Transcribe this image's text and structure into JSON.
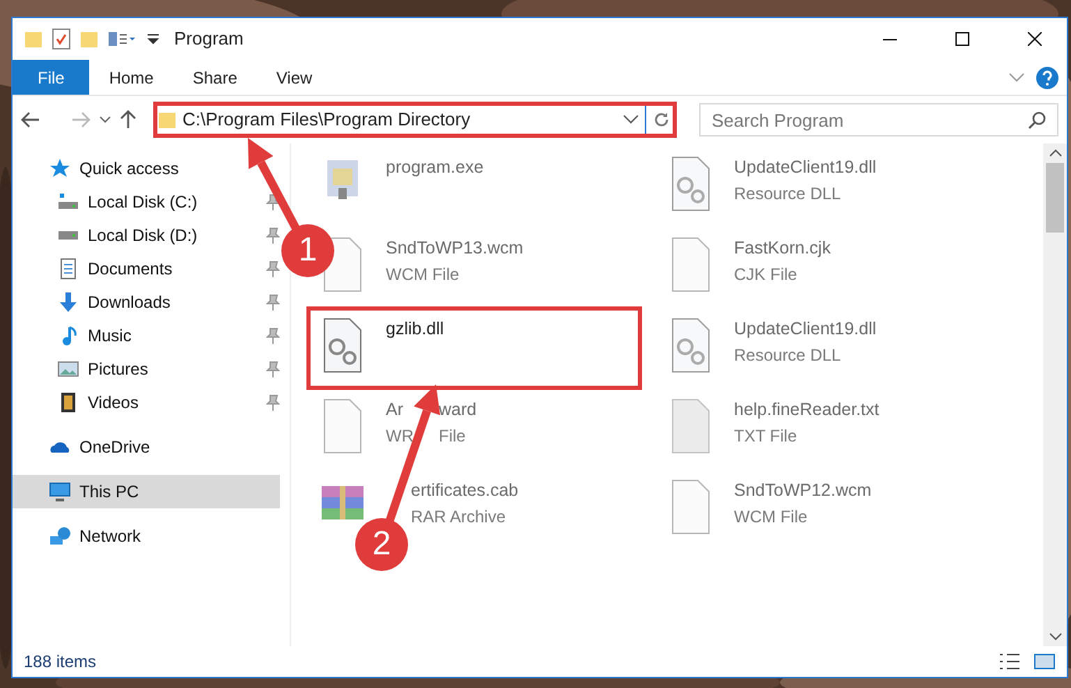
{
  "window": {
    "title": "Program"
  },
  "ribbon_tabs": [
    {
      "label": "File",
      "selected": true
    },
    {
      "label": "Home",
      "selected": false
    },
    {
      "label": "Share",
      "selected": false
    },
    {
      "label": "View",
      "selected": false
    }
  ],
  "address": {
    "path": "C:\\Program Files\\Program Directory",
    "highlighted": true
  },
  "search": {
    "placeholder": "Search Program"
  },
  "sidebar": {
    "items": [
      {
        "label": "Quick access",
        "kind": "star",
        "selected": false,
        "children": [
          {
            "label": "Local Disk (C:)",
            "kind": "disk-c",
            "pinned": true,
            "selected": false
          },
          {
            "label": "Local Disk (D:)",
            "kind": "disk",
            "pinned": true,
            "selected": false
          },
          {
            "label": "Documents",
            "kind": "documents",
            "pinned": true,
            "selected": false
          },
          {
            "label": "Downloads",
            "kind": "downloads",
            "pinned": true,
            "selected": false
          },
          {
            "label": "Music",
            "kind": "music",
            "pinned": true,
            "selected": false
          },
          {
            "label": "Pictures",
            "kind": "pictures",
            "pinned": true,
            "selected": false
          },
          {
            "label": "Videos",
            "kind": "videos",
            "pinned": true,
            "selected": false
          }
        ]
      },
      {
        "label": "OneDrive",
        "kind": "cloud",
        "selected": false
      },
      {
        "label": "This PC",
        "kind": "pc",
        "selected": true
      },
      {
        "label": "Network",
        "kind": "network",
        "selected": false
      }
    ]
  },
  "files": [
    {
      "name": "program.exe",
      "kind": "exe",
      "faded": true,
      "highlighted": false
    },
    {
      "name": "UpdateClient19.dll",
      "type": "Resource DLL",
      "kind": "dll",
      "faded": true,
      "highlighted": false
    },
    {
      "name": "SndToWP13.wcm",
      "type": "WCM File",
      "kind": "blank",
      "faded": true,
      "highlighted": false
    },
    {
      "name": "FastKorn.cjk",
      "type": "CJK File",
      "kind": "blank",
      "faded": true,
      "highlighted": false
    },
    {
      "name": "gzlib.dll",
      "kind": "dll",
      "faded": false,
      "highlighted": true
    },
    {
      "name": "UpdateClient19.dll",
      "type": "Resource DLL",
      "kind": "dll",
      "faded": true,
      "highlighted": false
    },
    {
      "name": "Ar",
      "name_rest": "ward",
      "type": "WR",
      "type_rest": "File",
      "kind": "blank",
      "faded": true,
      "highlighted": false
    },
    {
      "name": "help.fineReader.txt",
      "type": "TXT File",
      "kind": "txt",
      "faded": true,
      "highlighted": false
    },
    {
      "name": "ertificates.cab",
      "type": "RAR Archive",
      "kind": "rar",
      "faded": true,
      "highlighted": false
    },
    {
      "name": "SndToWP12.wcm",
      "type": "WCM File",
      "kind": "blank",
      "faded": true,
      "highlighted": false
    }
  ],
  "status_bar": {
    "count": "188 items"
  },
  "steps": [
    {
      "number": "1"
    },
    {
      "number": "2"
    }
  ]
}
